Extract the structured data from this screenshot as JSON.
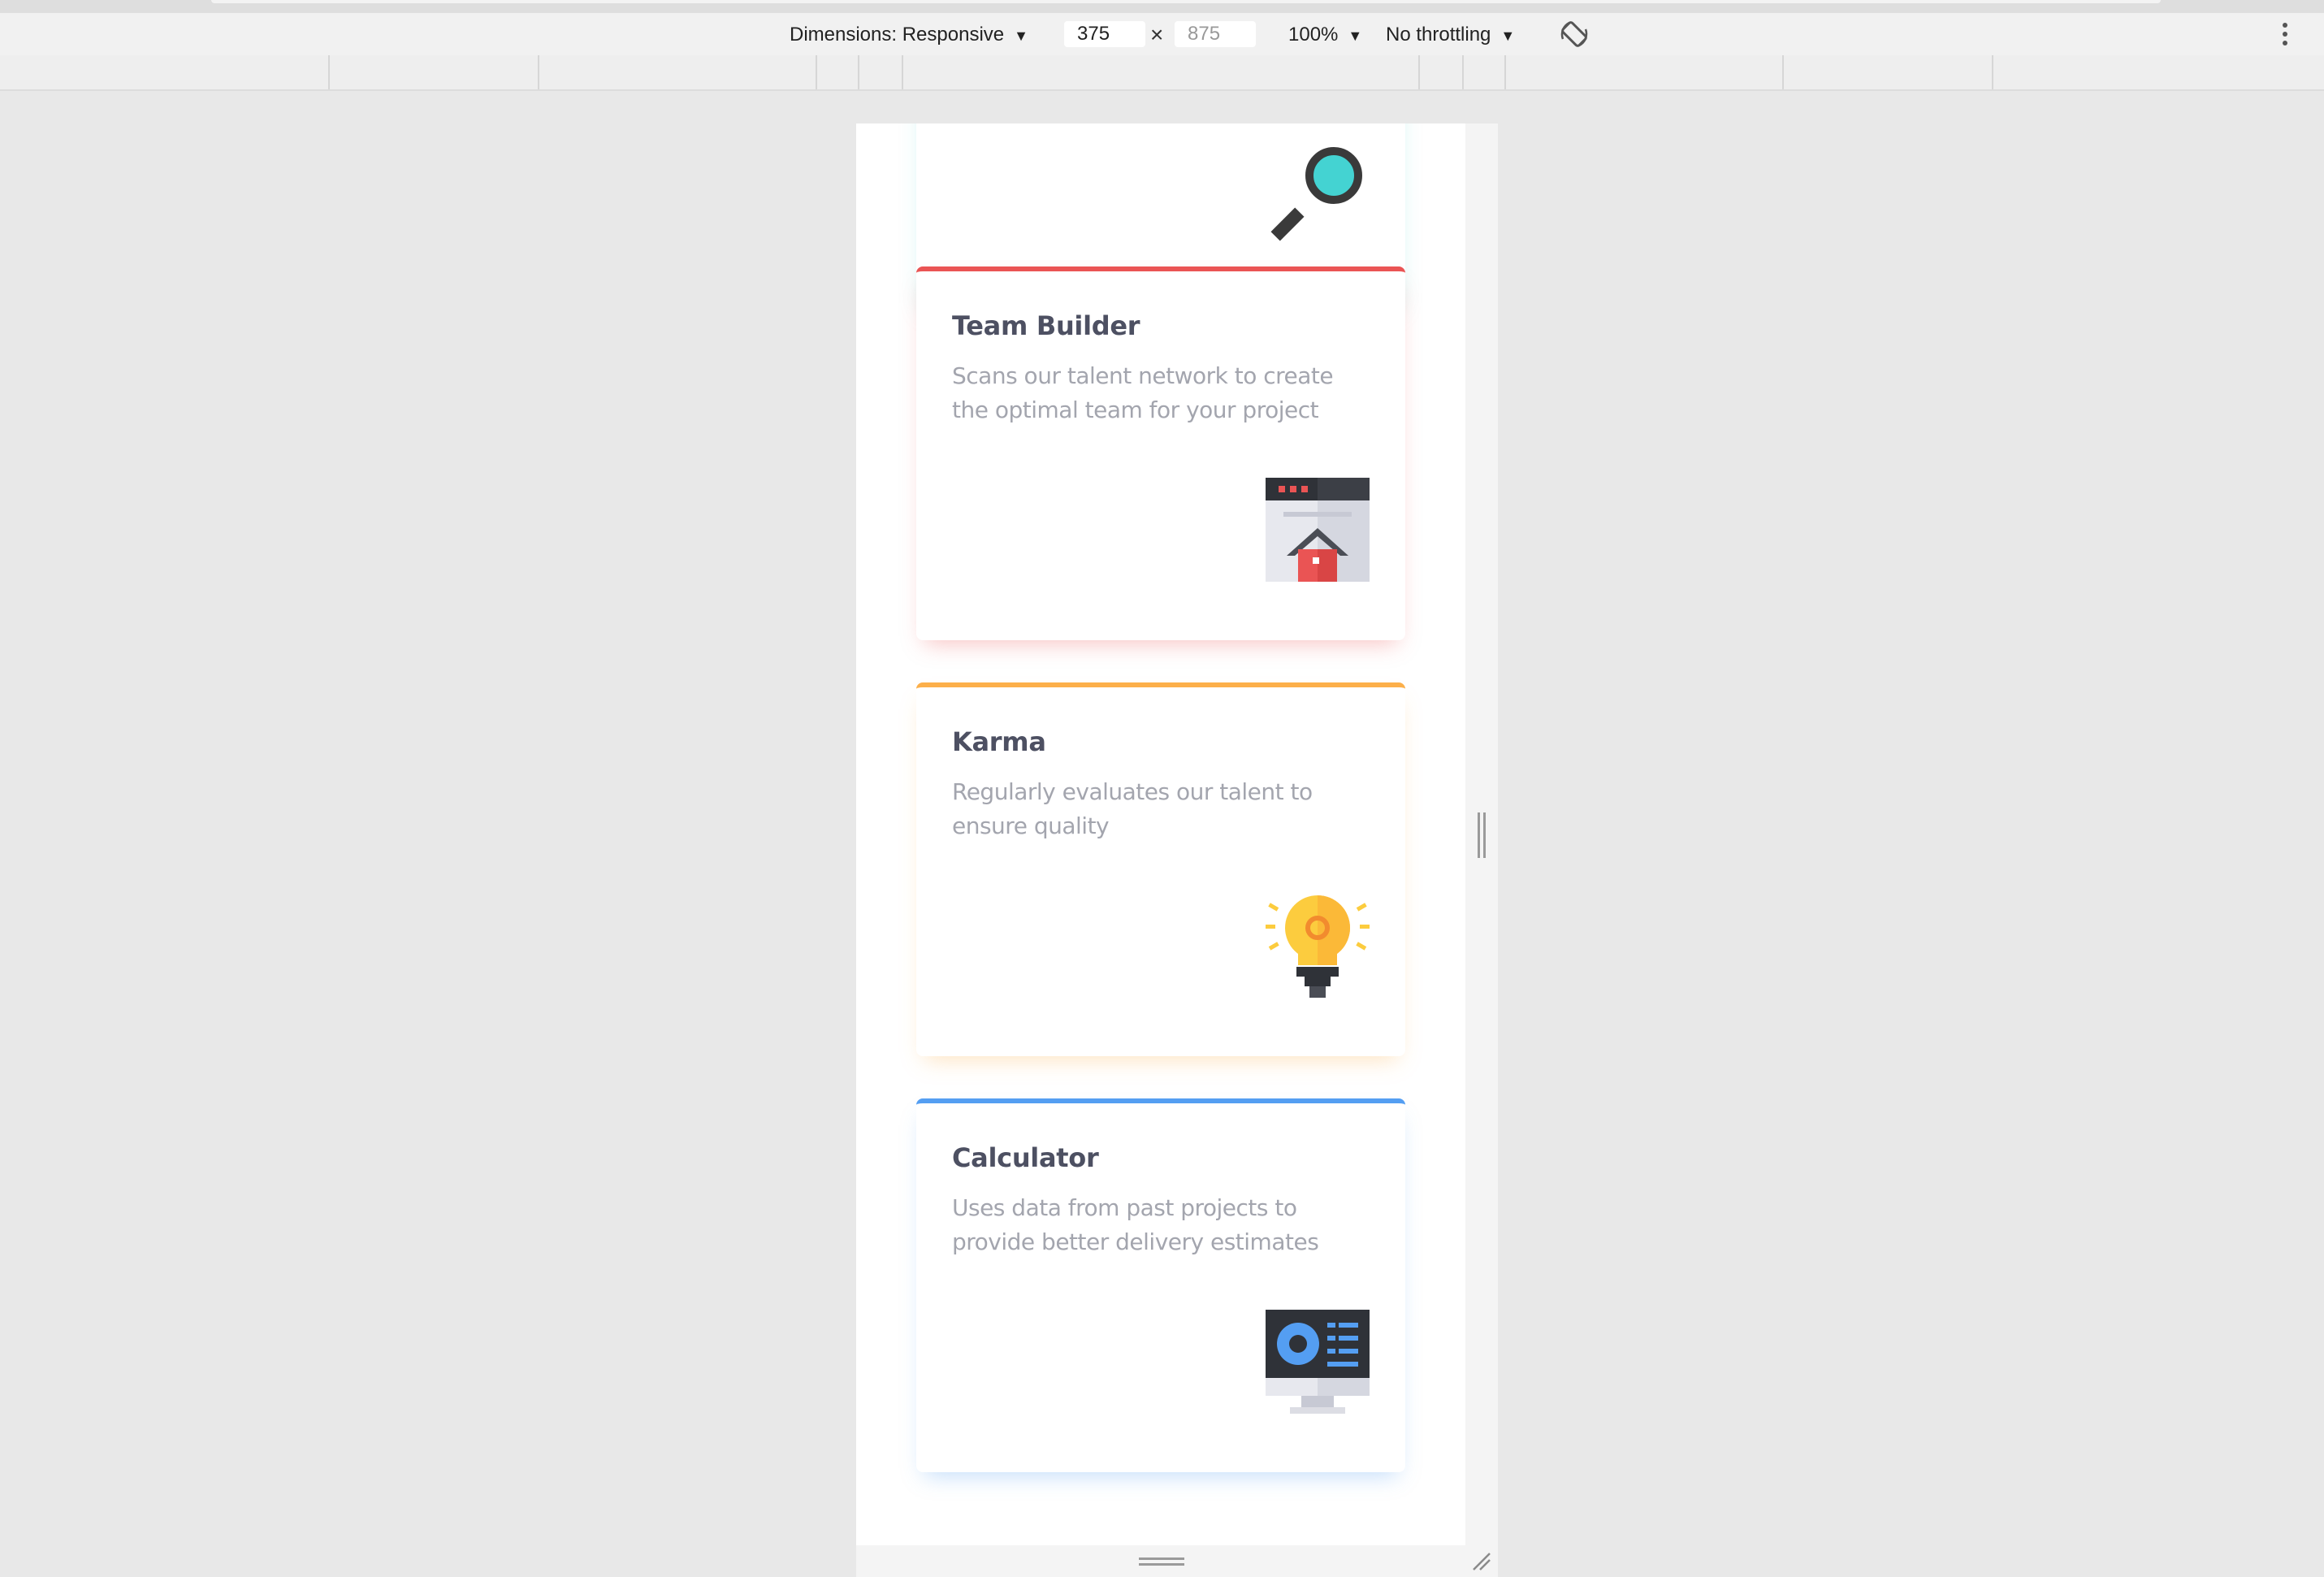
{
  "devtools": {
    "dimensions_label": "Dimensions: Responsive",
    "width_value": "375",
    "height_value": "875",
    "times_sign": "×",
    "zoom_label": "100%",
    "throttling_label": "No throttling"
  },
  "cards": [
    {
      "title": "",
      "description": "",
      "accent": "#44d3d2",
      "icon": "magnifier-icon"
    },
    {
      "title": "Team Builder",
      "description": "Scans our talent network to create the optimal team for your project",
      "accent": "#ea5454",
      "icon": "team-builder-icon"
    },
    {
      "title": "Karma",
      "description": "Regularly evaluates our talent to ensure quality",
      "accent": "#fcaf4a",
      "icon": "lightbulb-icon"
    },
    {
      "title": "Calculator",
      "description": "Uses data from past projects to provide better delivery estimates",
      "accent": "#549ef2",
      "icon": "monitor-calculator-icon"
    }
  ]
}
